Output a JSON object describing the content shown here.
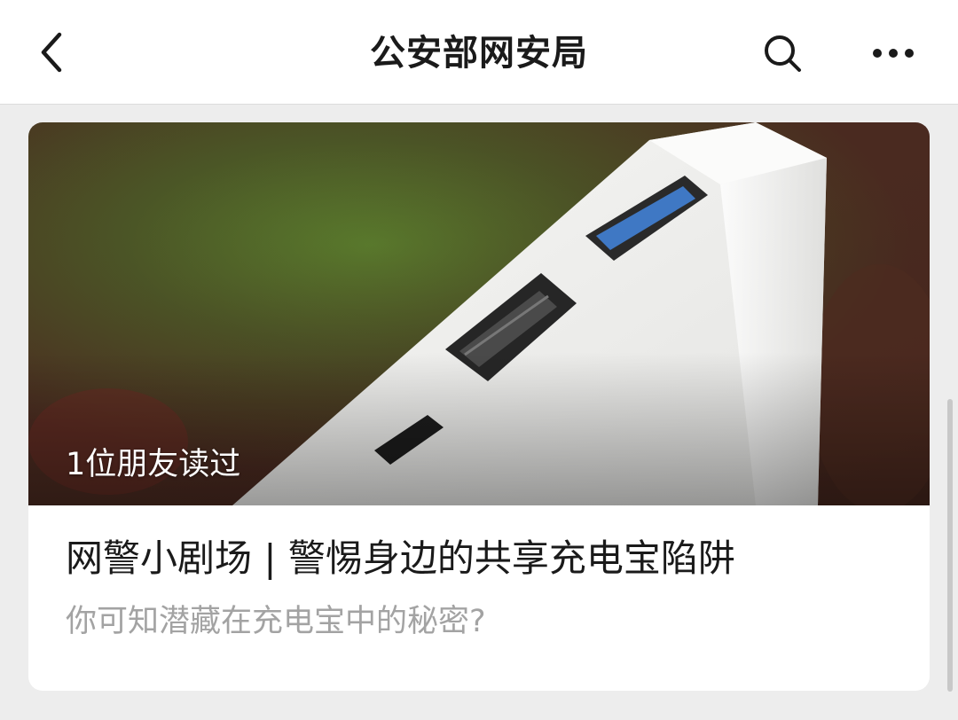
{
  "navbar": {
    "title": "公安部网安局",
    "back_icon": "chevron-left-icon",
    "search_icon": "search-icon",
    "more_icon": "more-horizontal-icon"
  },
  "article": {
    "read_by_friends": "1位朋友读过",
    "title": "网警小剧场 | 警惕身边的共享充电宝陷阱",
    "subtitle": "你可知潜藏在充电宝中的秘密?",
    "cover_description_icon": "power-bank-photo"
  },
  "colors": {
    "navbar_bg": "#ffffff",
    "page_bg": "#ededed",
    "title_text": "#1a1a1a",
    "subtitle_text": "#a3a3a3"
  }
}
